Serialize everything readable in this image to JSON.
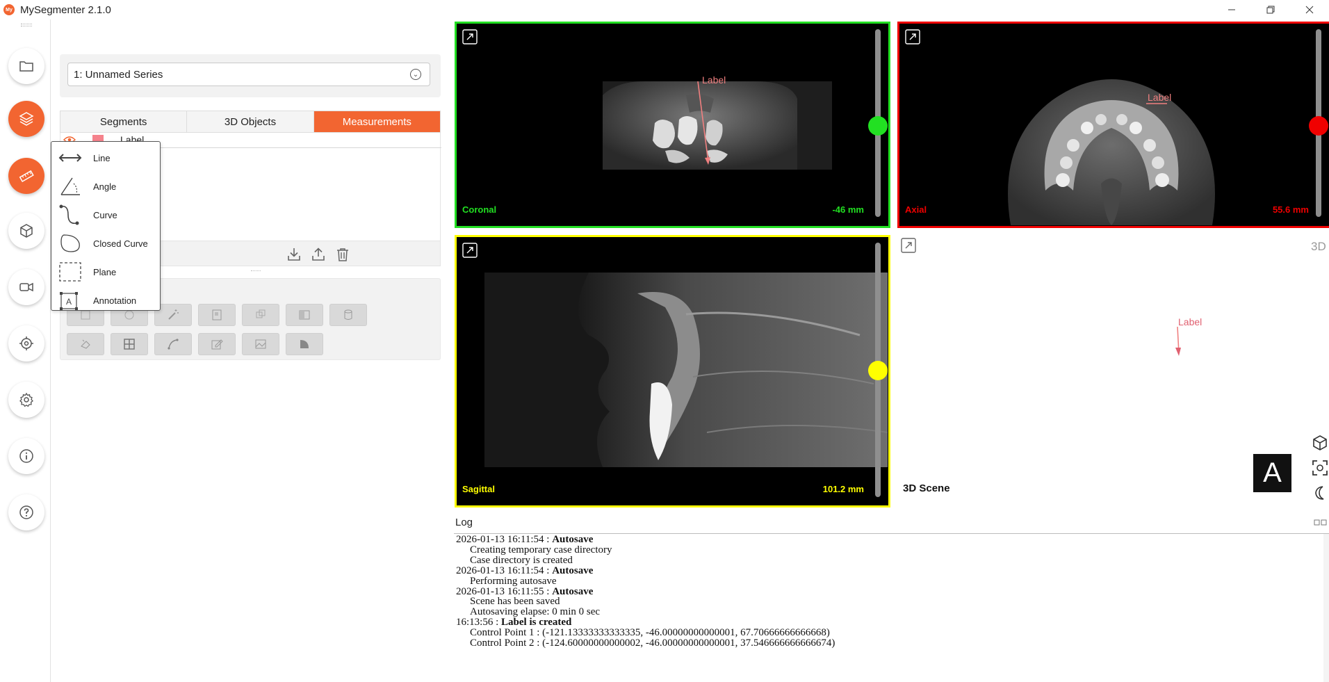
{
  "app": {
    "title": "MySegmenter 2.1.0",
    "logo_text": "My",
    "accent": "#f26531"
  },
  "window_controls": [
    "minimize-icon",
    "restore-icon",
    "close-icon"
  ],
  "rail": {
    "items": [
      {
        "name": "open-folder",
        "icon": "folder-icon",
        "active": false
      },
      {
        "name": "layers",
        "icon": "layers-icon",
        "active": true
      },
      {
        "name": "measure",
        "icon": "ruler-icon",
        "active": true
      },
      {
        "name": "3d-objects",
        "icon": "cube-icon",
        "active": false
      },
      {
        "name": "video",
        "icon": "video-camera-icon",
        "active": false
      },
      {
        "name": "target",
        "icon": "crosshair-icon",
        "active": false
      },
      {
        "name": "settings",
        "icon": "gear-icon",
        "active": false
      },
      {
        "name": "info",
        "icon": "info-icon",
        "active": false
      },
      {
        "name": "help",
        "icon": "help-icon",
        "active": false
      }
    ]
  },
  "series": {
    "selected": "1: Unnamed Series"
  },
  "tabs": [
    {
      "label": "Segments",
      "active": false
    },
    {
      "label": "3D Objects",
      "active": false
    },
    {
      "label": "Measurements",
      "active": true
    }
  ],
  "measurements": [
    {
      "name": "Label",
      "color": "#f5828c",
      "visible": true
    }
  ],
  "measurement_actions": [
    "import-icon",
    "export-icon",
    "trash-icon"
  ],
  "flyout": {
    "items": [
      {
        "label": "Line",
        "icon": "line-icon"
      },
      {
        "label": "Angle",
        "icon": "angle-icon"
      },
      {
        "label": "Curve",
        "icon": "curve-icon"
      },
      {
        "label": "Closed Curve",
        "icon": "closed-curve-icon"
      },
      {
        "label": "Plane",
        "icon": "plane-icon"
      },
      {
        "label": "Annotation",
        "icon": "annotation-icon"
      }
    ]
  },
  "viewports": {
    "coronal": {
      "name": "Coronal",
      "position": "-46 mm",
      "color": "#22e022",
      "label": "Label",
      "slider_level": 0.51
    },
    "axial": {
      "name": "Axial",
      "position": "55.6 mm",
      "color": "#f00000",
      "label": "Label",
      "slider_level": 0.51
    },
    "sagittal": {
      "name": "Sagittal",
      "position": "101.2 mm",
      "color": "#ffff00",
      "slider_level": 0.51
    },
    "v3d": {
      "tag": "3D",
      "name": "3D Scene",
      "label": "Label",
      "orientation": "A"
    }
  },
  "log": {
    "title": "Log",
    "lines": [
      {
        "ts": "2026-01-13 16:11:54 : ",
        "bold": "Autosave",
        "indent": false
      },
      {
        "text": "Creating temporary case directory",
        "indent": true
      },
      {
        "text": "Case directory is created",
        "indent": true
      },
      {
        "ts": "2026-01-13 16:11:54 : ",
        "bold": "Autosave",
        "indent": false
      },
      {
        "text": "Performing autosave",
        "indent": true
      },
      {
        "ts": "2026-01-13 16:11:55 : ",
        "bold": "Autosave",
        "indent": false
      },
      {
        "text": "Scene has been saved",
        "indent": true
      },
      {
        "text": "Autosaving elapse: 0 min 0 sec",
        "indent": true
      },
      {
        "ts": "16:13:56 : ",
        "bold": "Label is created",
        "indent": false
      },
      {
        "text": "Control Point 1 : (-121.13333333333335, -46.00000000000001, 67.70666666666668)",
        "indent": true
      },
      {
        "text": "Control Point 2 : (-124.60000000000002, -46.00000000000001, 37.546666666666674)",
        "indent": true
      }
    ]
  }
}
